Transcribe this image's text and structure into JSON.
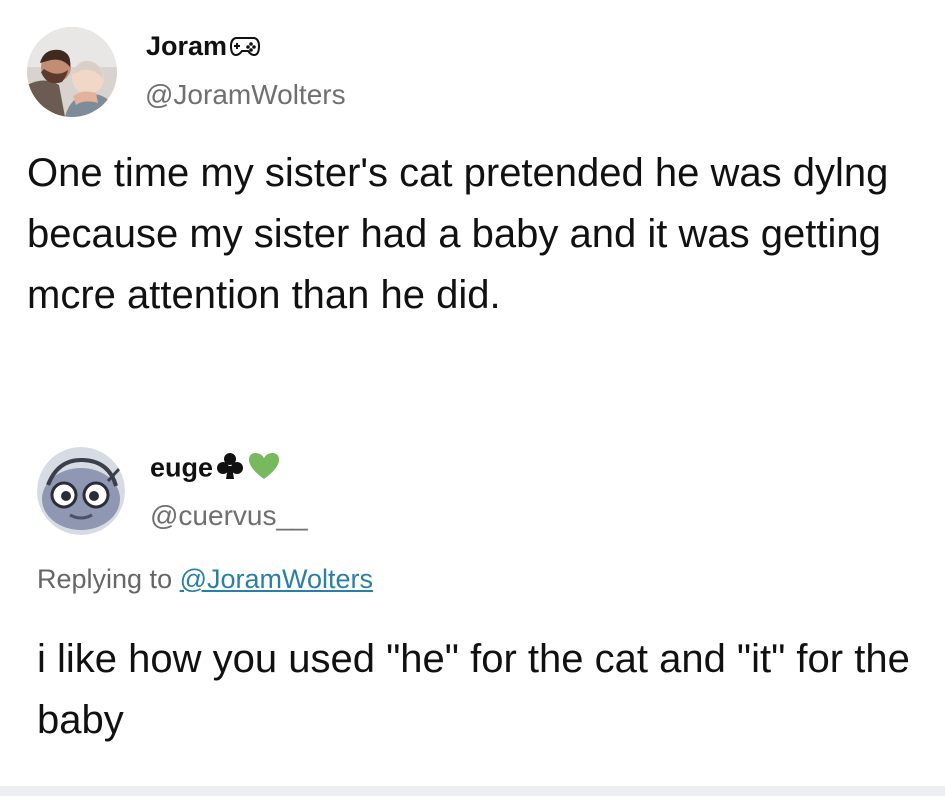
{
  "tweet": {
    "author": {
      "display_name": "Joram",
      "name_icon": "gamepad-icon",
      "handle": "@JoramWolters"
    },
    "text": "One time my sister's cat pretended he was dylng because my sister had a baby and it was getting mcre attention than he did."
  },
  "reply": {
    "author": {
      "display_name": "euge",
      "name_icons": [
        "club-icon",
        "green-heart-icon"
      ],
      "handle": "@cuervus__"
    },
    "replying_label": "Replying to",
    "replying_to": "@JoramWolters",
    "text": "i like how you used \"he\" for the cat and \"it\" for the baby"
  },
  "colors": {
    "handle": "#6f6f6f",
    "link": "#2a7fa8",
    "heart": "#78b85f",
    "text": "#111111"
  }
}
